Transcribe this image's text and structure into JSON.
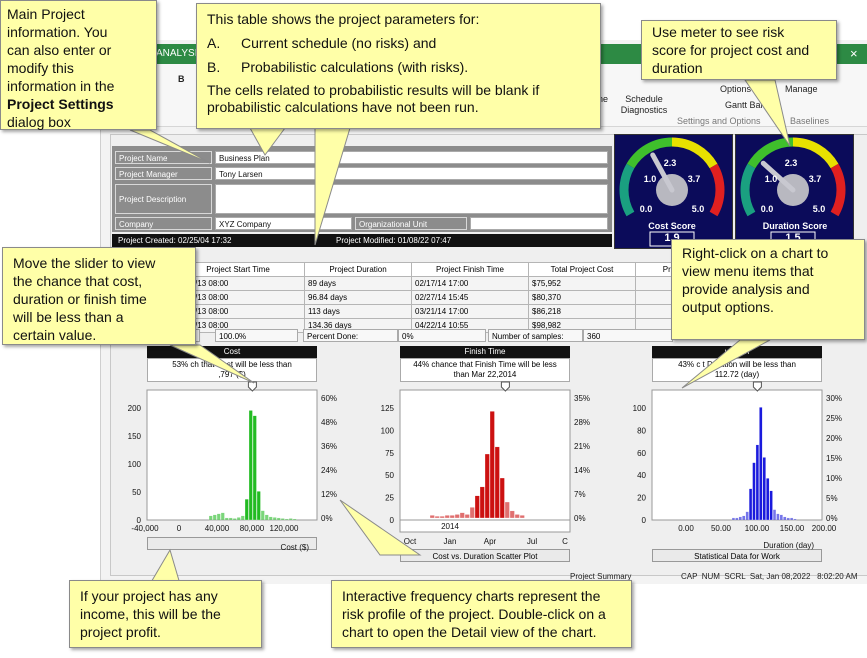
{
  "app": {
    "tab_fragment": "ANALYSIS",
    "ribbon": {
      "schedule_diagnostics": "Schedule Diagnostics",
      "options": "Options",
      "gantt_bar": "Gantt Bar",
      "manage": "Manage",
      "settings_group": "Settings and Options",
      "baselines_group": "Baselines",
      "bold_b": "B",
      "fragment_ne": "ne",
      "close_x": "×"
    },
    "project": {
      "name_label": "Project Name",
      "name_value": "Business Plan",
      "manager_label": "Project Manager",
      "manager_value": "Tony Larsen",
      "description_label": "Project Description",
      "company_label": "Company",
      "company_value": "XYZ Company",
      "org_unit_label": "Organizational Unit",
      "created": "Project Created: 02/25/04 17:32",
      "modified": "Project Modified: 01/08/22 07:47"
    },
    "table": {
      "headers": [
        "",
        "Project Start Time",
        "Project Duration",
        "Project Finish Time",
        "Total Project Cost",
        "Pro"
      ],
      "rows": [
        [
          "Schedu",
          "10/16/13 08:00",
          "89 days",
          "02/17/14 17:00",
          "$75,952",
          ""
        ],
        [
          "",
          "10/16/13 08:00",
          "96.84 days",
          "02/27/14 15:45",
          "$80,370",
          ""
        ],
        [
          "s",
          "10/16/13 08:00",
          "113 days",
          "03/21/14 17:00",
          "$86,218",
          ""
        ],
        [
          "",
          "10/16/13 08:00",
          "134.36 days",
          "04/22/14 10:55",
          "$98,982",
          ""
        ]
      ]
    },
    "stats": {
      "done_label": "e:",
      "done_value": "100.0%",
      "percent_done_label": "Percent Done:",
      "percent_done_value": "0%",
      "samples_label": "Number of samples:",
      "samples_value": "360"
    },
    "gauges": [
      {
        "title": "Cost Score",
        "ticks": [
          "0.0",
          "1.0",
          "2.3",
          "3.7",
          "5.0"
        ],
        "readout": "1.9",
        "level": 0.38
      },
      {
        "title": "Duration Score",
        "ticks": [
          "0.0",
          "1.0",
          "2.3",
          "3.7",
          "5.0"
        ],
        "readout": "1.5",
        "level": 0.3
      }
    ],
    "charts": [
      {
        "title": "Cost",
        "desc1": "53% ch        that Cost will be less than",
        "desc2": "         ,797 ($)",
        "y_ticks_left": [
          "200",
          "150",
          "100",
          "50",
          "0"
        ],
        "y_ticks_right": [
          "60%",
          "48%",
          "36%",
          "24%",
          "12%",
          "0%"
        ],
        "x_ticks": [
          "-40,000",
          "0",
          "40,000",
          "80,000",
          "120,000"
        ],
        "xlabel": "Cost ($)",
        "button": "",
        "color": "#22bb22"
      },
      {
        "title": "Finish Time",
        "desc1": "44% chance that Finish Time will be less",
        "desc2": "than Mar 22,2014",
        "y_ticks_left": [
          "125",
          "100",
          "75",
          "50",
          "25",
          "0"
        ],
        "y_ticks_right": [
          "35%",
          "28%",
          "21%",
          "14%",
          "7%",
          "0%"
        ],
        "year_label": "2014",
        "x_ticks": [
          "Oct",
          "Jan",
          "Apr",
          "Jul",
          "C"
        ],
        "button": "Cost vs. Duration Scatter Plot",
        "color": "#cc1111"
      },
      {
        "title": "uration",
        "desc1": "43% c            t Duration will be less than",
        "desc2": "112.72 (day)",
        "y_ticks_left": [
          "100",
          "80",
          "60",
          "40",
          "20",
          "0"
        ],
        "y_ticks_right": [
          "30%",
          "25%",
          "20%",
          "15%",
          "10%",
          "5%",
          "0%"
        ],
        "x_ticks": [
          "0.00",
          "50.00",
          "100.00",
          "150.00",
          "200.00"
        ],
        "xlabel": "Duration (day)",
        "button": "Statistical Data for Work",
        "color": "#1a1add"
      }
    ],
    "status": {
      "project_summary": "Project Summary",
      "indicators": "CAP  NUM  SCRL  Sat, Jan 08,2022   8:02:20 AM"
    }
  },
  "chart_data": [
    {
      "type": "bar",
      "title": "Cost",
      "xlabel": "Cost ($)",
      "xlim": [
        -40000,
        140000
      ],
      "ylim": [
        0,
        230
      ],
      "x": [
        40000,
        44000,
        48000,
        52000,
        56000,
        60000,
        64000,
        68000,
        72000,
        76000,
        80000,
        84000,
        88000,
        92000,
        96000,
        100000,
        104000,
        108000,
        112000,
        116000,
        120000,
        124000
      ],
      "values": [
        8,
        10,
        12,
        14,
        4,
        4,
        3,
        5,
        8,
        40,
        210,
        200,
        55,
        18,
        10,
        6,
        5,
        4,
        3,
        2,
        3,
        2
      ]
    },
    {
      "type": "bar",
      "title": "Finish Time",
      "x_categories_label": "2014",
      "ylim": [
        0,
        135
      ],
      "x": [
        "Nov-20",
        "Nov-30",
        "Dec-10",
        "Dec-20",
        "Dec-30",
        "Jan-9",
        "Jan-19",
        "Jan-29",
        "Feb-8",
        "Feb-18",
        "Feb-28",
        "Mar-10",
        "Mar-20",
        "Mar-30",
        "Apr-9",
        "Apr-19",
        "Apr-29",
        "May-9",
        "May-19"
      ],
      "values": [
        3,
        2,
        2,
        3,
        3,
        4,
        6,
        4,
        12,
        25,
        35,
        72,
        120,
        80,
        45,
        18,
        8,
        4,
        3
      ]
    },
    {
      "type": "bar",
      "title": "Duration",
      "xlabel": "Duration (day)",
      "xlim": [
        0,
        200
      ],
      "ylim": [
        0,
        115
      ],
      "x": [
        70,
        75,
        80,
        85,
        90,
        95,
        100,
        105,
        110,
        115,
        120,
        125,
        130,
        135,
        140,
        145,
        150,
        155,
        160
      ],
      "values": [
        2,
        2,
        3,
        4,
        8,
        30,
        55,
        72,
        108,
        60,
        40,
        28,
        10,
        6,
        5,
        3,
        2,
        2,
        1
      ]
    }
  ],
  "callouts": {
    "main_info_1": "Main Project",
    "main_info_2": "information. You",
    "main_info_3": "can also enter or",
    "main_info_4": "modify this",
    "main_info_5": "information in the",
    "main_info_bold": "Project Settings",
    "main_info_6": "dialog box",
    "table_1": "This table shows the project parameters for:",
    "table_a_letter": "A.",
    "table_a": "Current schedule (no risks) and",
    "table_b_letter": "B.",
    "table_b": "Probabilistic calculations (with risks).",
    "table_2": "The cells related to probabilistic results will be blank if probabilistic calculations have not been run.",
    "meter_1": "Use meter to see risk",
    "meter_2": "score for project cost and",
    "meter_3": "duration",
    "rightclick_1": "Right-click on a chart to",
    "rightclick_2": "view menu items that",
    "rightclick_3": "provide analysis and",
    "rightclick_4": "output options.",
    "slider_1": "Move the slider to view",
    "slider_2": "the chance that cost,",
    "slider_3": "duration or finish time",
    "slider_4": "will be less than a",
    "slider_5": "certain value.",
    "income_1": "If your project has any",
    "income_2": "income, this will be the",
    "income_3": "project profit.",
    "freq_1": "Interactive frequency charts represent the",
    "freq_2": "risk profile of the project. Double-click on a",
    "freq_3": "chart to open the Detail view of the chart."
  }
}
